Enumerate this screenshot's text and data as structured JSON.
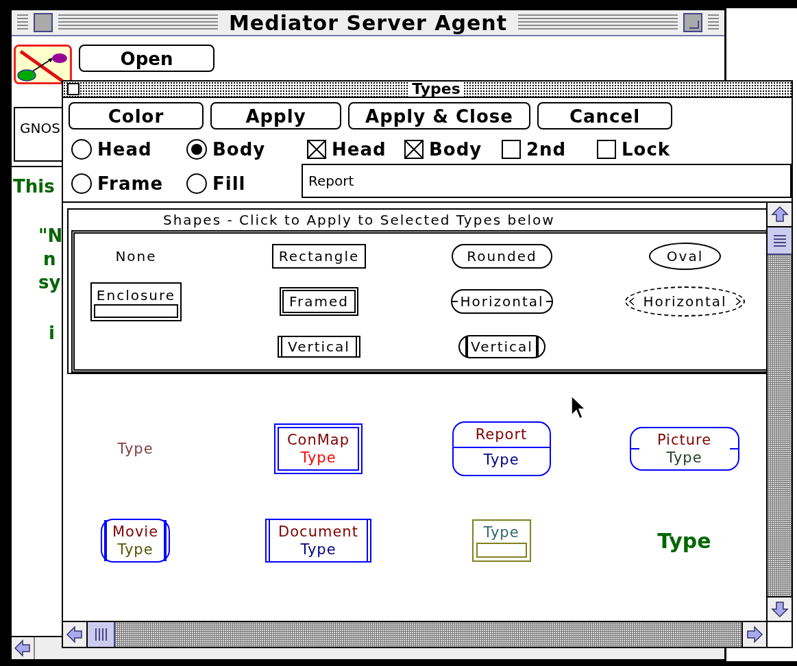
{
  "back_window": {
    "title": "Mediator Server Agent",
    "button": "Open",
    "field": "GNOS",
    "text_lines": [
      "This",
      "\"N",
      "n",
      "sy",
      "i"
    ]
  },
  "types_window": {
    "title": "Types",
    "buttons": [
      "Color",
      "Apply",
      "Apply & Close",
      "Cancel"
    ],
    "radios": [
      {
        "label": "Head",
        "selected": false
      },
      {
        "label": "Body",
        "selected": true
      },
      {
        "label": "Frame",
        "selected": false
      },
      {
        "label": "Fill",
        "selected": false
      }
    ],
    "checkboxes": [
      {
        "label": "Head",
        "checked": true
      },
      {
        "label": "Body",
        "checked": true
      },
      {
        "label": "2nd",
        "checked": false
      },
      {
        "label": "Lock",
        "checked": false
      }
    ],
    "name_field": {
      "value": "Report"
    },
    "shapes": {
      "title": "Shapes - Click to Apply to Selected Types below",
      "items": [
        {
          "label": "None",
          "kind": "none"
        },
        {
          "label": "Rectangle",
          "kind": "rectangle"
        },
        {
          "label": "Rounded",
          "kind": "rounded"
        },
        {
          "label": "Oval",
          "kind": "oval"
        },
        {
          "label": "Enclosure",
          "kind": "enclosure"
        },
        {
          "label": "Framed",
          "kind": "framed"
        },
        {
          "label": "Horizontal",
          "kind": "rounded-h"
        },
        {
          "label": "Horizontal",
          "kind": "oval-h"
        },
        {
          "label": "Vertical",
          "kind": "vertical"
        },
        {
          "label": "Vertical",
          "kind": "rounded-v"
        }
      ]
    },
    "samples": [
      {
        "kind": "plain",
        "body": {
          "text": "Type",
          "color": "#804040"
        }
      },
      {
        "kind": "framed",
        "color": "#0000ff",
        "head": {
          "text": "ConMap",
          "color": "#800000"
        },
        "body": {
          "text": "Type",
          "color": "#ff0000"
        }
      },
      {
        "kind": "divided",
        "color": "#0000ff",
        "head": {
          "text": "Report",
          "color": "#800000"
        },
        "body": {
          "text": "Type",
          "color": "#000080"
        }
      },
      {
        "kind": "notched",
        "color": "#0000ff",
        "head": {
          "text": "Picture",
          "color": "#800000"
        },
        "body": {
          "text": "Type",
          "color": "#204020"
        }
      },
      {
        "kind": "rounded-v",
        "color": "#0000ff",
        "head": {
          "text": "Movie",
          "color": "#800000"
        },
        "body": {
          "text": "Type",
          "color": "#555500"
        }
      },
      {
        "kind": "vertical",
        "color": "#0000ff",
        "head": {
          "text": "Document",
          "color": "#800000"
        },
        "body": {
          "text": "Type",
          "color": "#000080"
        }
      },
      {
        "kind": "enclosure",
        "color": "#808020",
        "body": {
          "text": "Type",
          "color": "#336666"
        }
      },
      {
        "kind": "bold",
        "body": {
          "text": "Type",
          "color": "#006600"
        }
      }
    ]
  }
}
